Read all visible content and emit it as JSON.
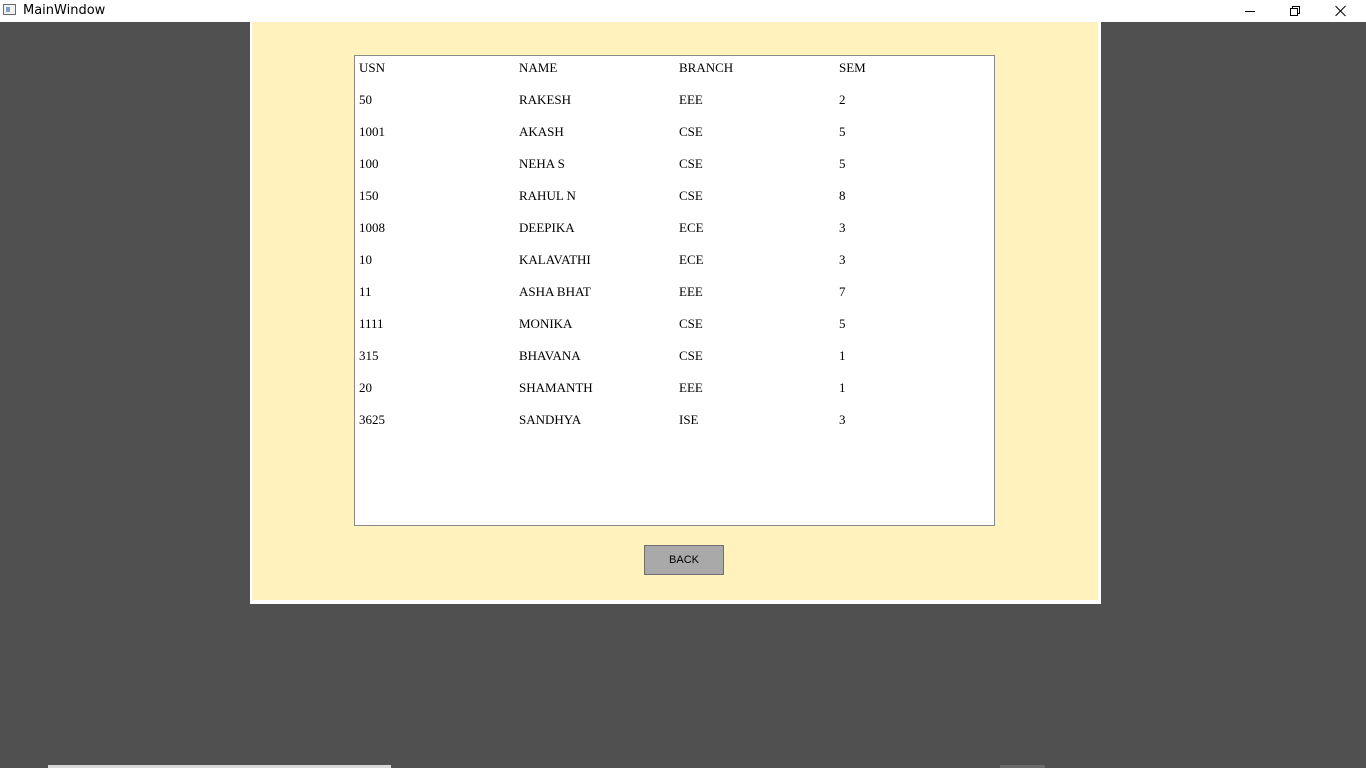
{
  "window": {
    "title": "MainWindow",
    "icon": "app-window-icon",
    "controls": [
      "minimize-icon",
      "restore-icon",
      "close-icon"
    ]
  },
  "colors": {
    "desktop": "#505050",
    "panel_background": "#fff2bd",
    "table_background": "#ffffff",
    "button_background": "#a9a9a9"
  },
  "table": {
    "headers": [
      "USN",
      "NAME",
      "BRANCH",
      "SEM"
    ],
    "rows": [
      [
        "50",
        "RAKESH",
        "EEE",
        "2"
      ],
      [
        "1001",
        "AKASH",
        "CSE",
        "5"
      ],
      [
        "100",
        "NEHA S",
        "CSE",
        "5"
      ],
      [
        "150",
        "RAHUL N",
        "CSE",
        "8"
      ],
      [
        "1008",
        "DEEPIKA",
        "ECE",
        "3"
      ],
      [
        "10",
        "KALAVATHI",
        "ECE",
        "3"
      ],
      [
        "11",
        "ASHA BHAT",
        "EEE",
        "7"
      ],
      [
        "1111",
        "MONIKA",
        "CSE",
        "5"
      ],
      [
        "315",
        "BHAVANA",
        "CSE",
        "1"
      ],
      [
        "20",
        "SHAMANTH",
        "EEE",
        "1"
      ],
      [
        "3625",
        "SANDHYA",
        "ISE",
        "3"
      ]
    ]
  },
  "actions": {
    "back_label": "BACK"
  }
}
